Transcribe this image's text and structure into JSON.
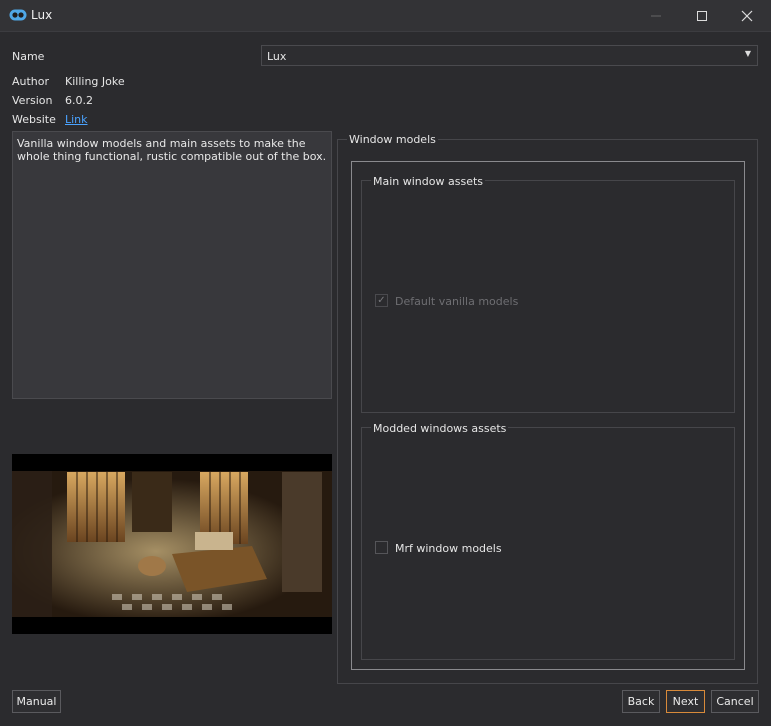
{
  "window": {
    "title": "Lux",
    "controls": {
      "minimize": "–",
      "maximize": "☐",
      "close": "✕"
    }
  },
  "fields": {
    "name_label": "Name",
    "name_value": "Lux",
    "author_label": "Author",
    "author_value": "Killing Joke",
    "version_label": "Version",
    "version_value": "6.0.2",
    "website_label": "Website",
    "website_value": "Link"
  },
  "description": "Vanilla window models and main assets to make the whole thing functional, rustic compatible out of the box.",
  "options": {
    "group_title": "Window models",
    "main_group_title": "Main window assets",
    "main_option_label": "Default vanilla models",
    "main_option_checked": true,
    "main_option_enabled": false,
    "modded_group_title": "Modded windows assets",
    "modded_option_label": "Mrf window models",
    "modded_option_checked": false
  },
  "buttons": {
    "manual": "Manual",
    "back": "Back",
    "next": "Next",
    "cancel": "Cancel"
  },
  "colors": {
    "background": "#2b2b2e",
    "link": "#4aa3ff",
    "focus_border": "#d88a3a",
    "app_icon": "#4fa8e8"
  },
  "icons": {
    "app": "app-logo-icon",
    "dropdown": "chevron-down-icon",
    "checkmark": "check-icon"
  }
}
